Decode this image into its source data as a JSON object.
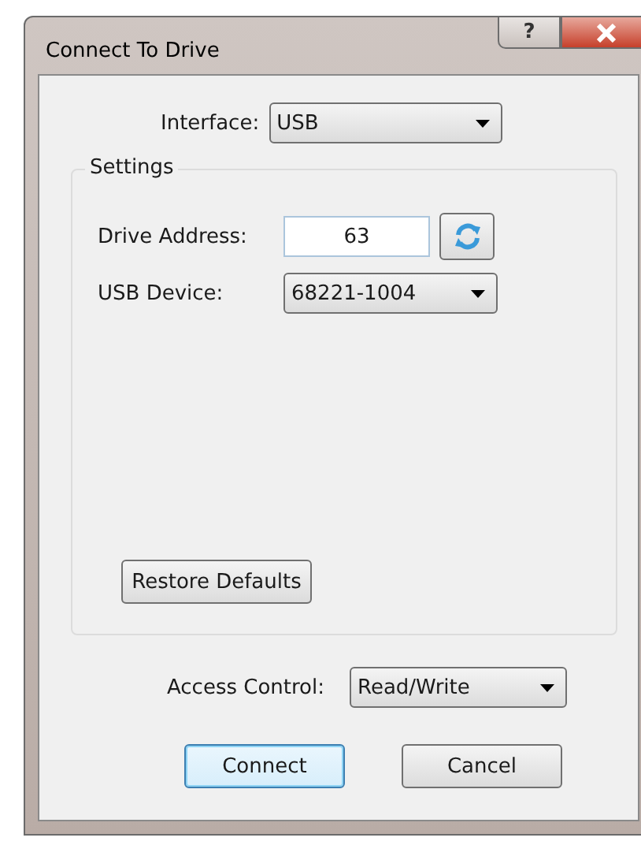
{
  "window": {
    "title": "Connect To Drive",
    "help_button": "?"
  },
  "interface": {
    "label": "Interface:",
    "value": "USB"
  },
  "settings": {
    "title": "Settings",
    "drive_address": {
      "label": "Drive Address:",
      "value": "63"
    },
    "usb_device": {
      "label": "USB Device:",
      "value": "68221-1004"
    },
    "restore_button": "Restore Defaults"
  },
  "access_control": {
    "label": "Access Control:",
    "value": "Read/Write"
  },
  "buttons": [
    {
      "label": "Connect",
      "default": true
    },
    {
      "label": "Cancel",
      "default": false
    }
  ]
}
